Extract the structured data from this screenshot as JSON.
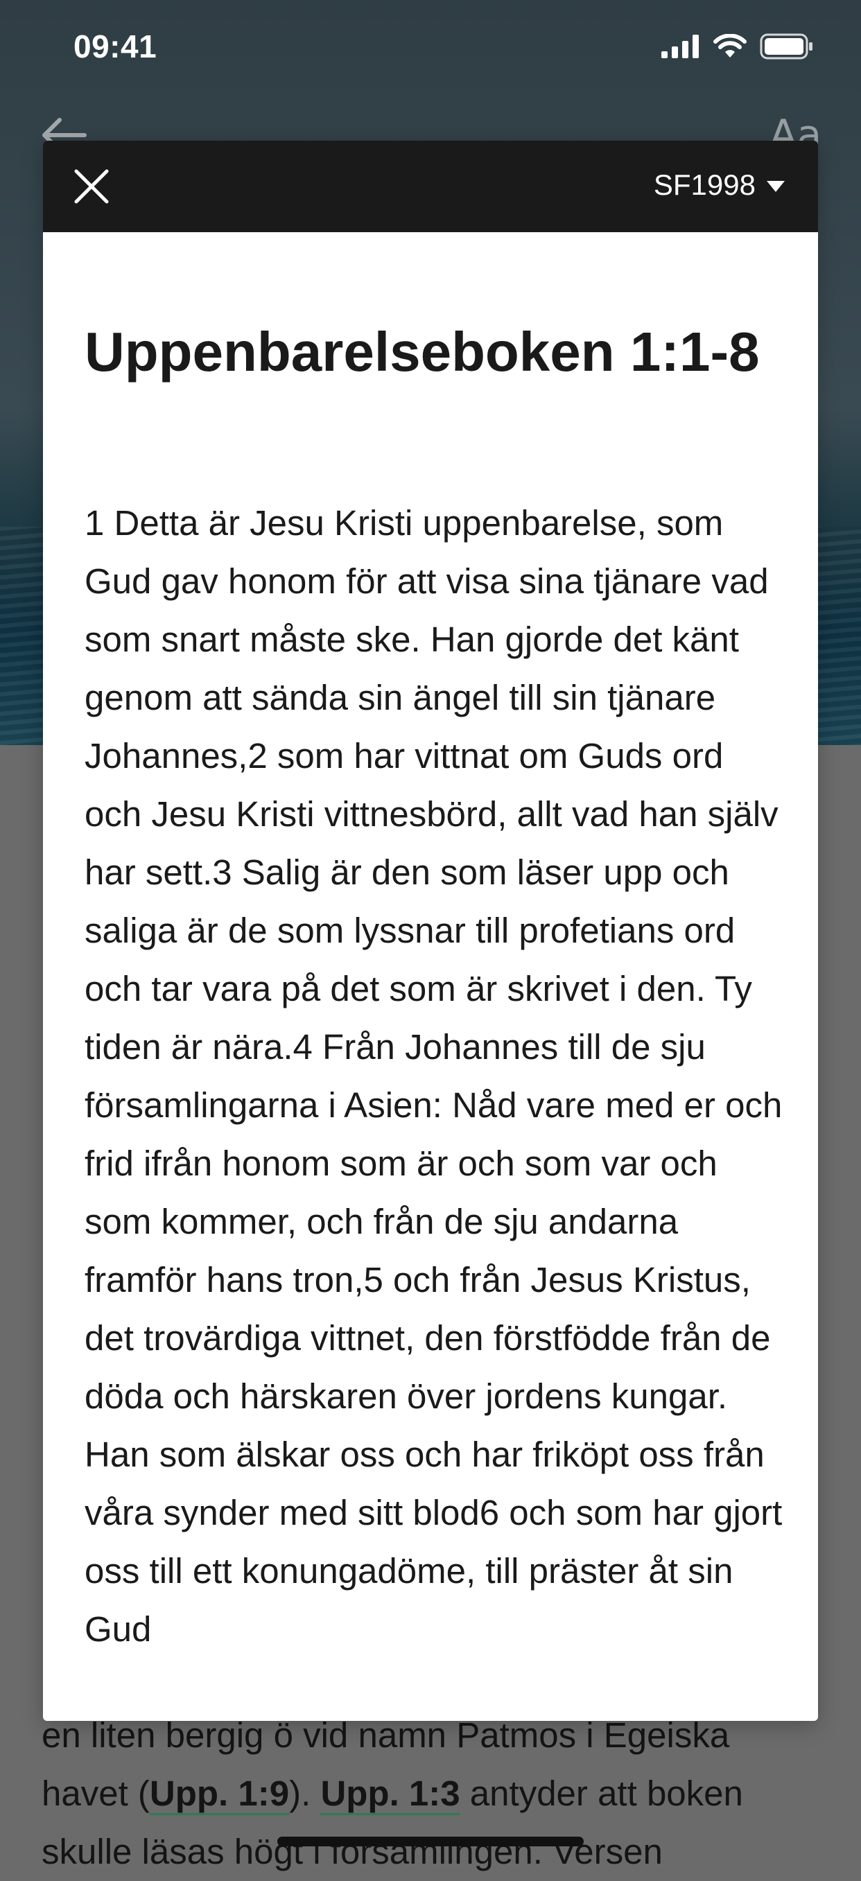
{
  "status_bar": {
    "time": "09:41"
  },
  "background": {
    "font_icon_label": "Aa",
    "paragraph": {
      "line1": "en liten bergig ö vid namn Patmos i Egeiska",
      "line2_pre": "havet (",
      "ref1": "Upp. 1:9",
      "line2_mid": "). ",
      "ref2": "Upp. 1:3",
      "line2_post": " antyder att boken",
      "line3": "skulle läsas högt i församlingen. Versen"
    }
  },
  "modal": {
    "version_label": "SF1998",
    "title": "Uppenbarelseboken 1:1-8",
    "text": "1 Detta är Jesu Kristi uppenbarelse, som Gud gav honom för att visa sina tjänare vad som snart måste ske. Han gjorde det känt genom att sända sin ängel till sin tjänare Johannes,2 som har vittnat om Guds ord och Jesu Kristi vittnesbörd, allt vad han själv har sett.3 Salig är den som läser upp och saliga är de som lyssnar till profetians ord och tar vara på det som är skrivet i den. Ty tiden är nära.4 Från Johannes till de sju församlingarna i Asien: Nåd vare med er och frid ifrån honom som är och som var och som kommer, och från de sju andarna framför hans tron,5 och från Jesus Kristus, det trovärdiga vittnet, den förstfödde från de döda och härskaren över jordens kungar. Han som älskar oss och har friköpt oss från våra synder med sitt blod6 och som har gjort oss till ett konungadöme, till präster åt sin Gud"
  },
  "colors": {
    "modal_header": "#1a1a1a",
    "overlay": "#6b6b6b",
    "link_underline": "#2f7a55"
  }
}
